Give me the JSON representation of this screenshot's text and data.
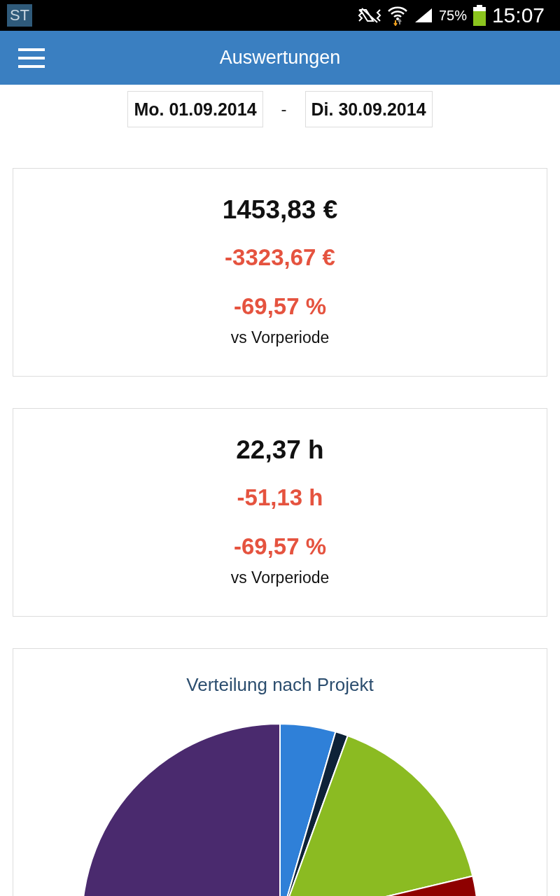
{
  "status_bar": {
    "app_badge": "ST",
    "battery": "75%",
    "time": "15:07"
  },
  "app_bar": {
    "title": "Auswertungen"
  },
  "date_range": {
    "start": "Mo. 01.09.2014",
    "separator": "-",
    "end": "Di. 30.09.2014"
  },
  "cards": [
    {
      "value": "1453,83 €",
      "delta": "-3323,67 €",
      "percent": "-69,57 %",
      "caption": "vs Vorperiode"
    },
    {
      "value": "22,37 h",
      "delta": "-51,13 h",
      "percent": "-69,57 %",
      "caption": "vs Vorperiode"
    }
  ],
  "chart_card": {
    "title": "Verteilung nach Projekt"
  }
}
